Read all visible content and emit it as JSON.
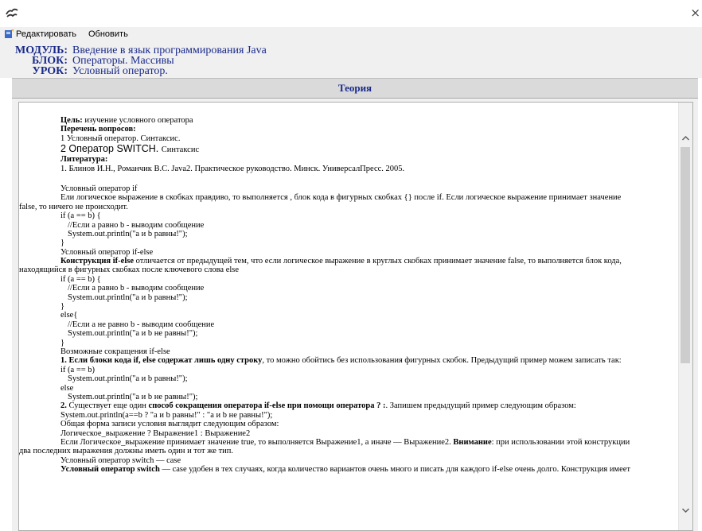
{
  "window": {
    "close_glyph": "×"
  },
  "menu": {
    "edit": "Редактировать",
    "refresh": "Обновить"
  },
  "info": {
    "module_label": "МОДУЛЬ:",
    "module_value": "Введение в язык программирования Java",
    "block_label": "БЛОК:",
    "block_value": "Операторы. Массивы",
    "lesson_label": "УРОК:",
    "lesson_value": "Условный оператор."
  },
  "tab": {
    "title": "Теория"
  },
  "colors": {
    "accent": "#1a2a8a",
    "panel": "#f0f0f0",
    "tab": "#dadada"
  },
  "content": {
    "goal_label": "Цель:",
    "goal_text": " изучение условного оператора",
    "questions_label": "Перечень вопросов:",
    "q1": "1 Условный оператор. Синтаксис.",
    "q2a": "2 Оператор SWITCH. ",
    "q2b": "Синтаксис",
    "lit_label": "Литература:",
    "lit1": "1. Блинов И.Н., Романчик В.С. Java2. Практическое руководство. Минск. УниверсалПресс. 2005.",
    "l_if_title": "Условный оператор if",
    "l_if_desc1": "Ели логическое выражение в скобках правдиво, то выполняется , блок кода в фигурных скобках {} после if. Если логическое выражение принимает значение",
    "l_if_desc2": "false, то ничего не происходит.",
    "c1": "if (a == b) {",
    "c2": "//Если a равно b - выводим сообщение",
    "c3": "System.out.println(\"a и b равны!\");",
    "c4": "}",
    "l_ifelse_title": "Условный оператор if-else",
    "l_ifelse_b": "Конструкция if-else",
    "l_ifelse_rest": " отличается от предыдущей тем, что если логическое выражение в круглых скобках принимает значение false, то выполняется блок кода,",
    "l_ifelse_2": "находящийся в фигурных скобках после ключевого слова else",
    "c5": "if (a == b) {",
    "c6": "//Если a равно b - выводим сообщение",
    "c7": "System.out.println(\"a и b равны!\");",
    "c8": "}",
    "c9": "else{",
    "c10": "//Если a не равно b - выводим сообщение",
    "c11": "System.out.println(\"a и b не равны!\");",
    "c12": "}",
    "l_short_title": "Возможные сокращения if-else",
    "l_short1_b": "1. Если блоки кода  if, else  содержат лишь одну строку",
    "l_short1_rest": ", то можно обойтись без использования фигурных скобок. Предыдущий пример можем записать так:",
    "c13": "if (a == b)",
    "c14": "System.out.println(\"a и b равны!\");",
    "c15": "else",
    "c16": "System.out.println(\"a и b не равны!\");",
    "l_short2_b1": "2.",
    "l_short2_t1": " Существует еще один ",
    "l_short2_b2": "способ сокращения оператора if-else при помощи оператора ? :",
    "l_short2_t2": ". Запишем предыдущий пример следующим образом:",
    "c17": "System.out.println(a==b ? \"a и b равны!\" : \"a и b не равны!\");",
    "l_form": "Общая форма записи условия выглядит следующим образом:",
    "l_form_expr": "Логическое_выражение ? Выражение1 : Выражение2",
    "l_if_true1a": "Если Логическое_выражение принимает значение true, то выполняется Выражение1, а иначе — Выражение2. ",
    "l_if_true1b": "Внимание",
    "l_if_true1c": ": при использовании этой конструкции",
    "l_if_true2": "два последних выражения должны иметь один и тот же тип.",
    "l_switch_title": "Условный оператор switch — case",
    "l_switch_b": "Условный оператор switch",
    "l_switch_rest": " — case удобен в тех случаях, когда количество вариантов очень много и писать для каждого if-else очень долго. Конструкция имеет"
  }
}
